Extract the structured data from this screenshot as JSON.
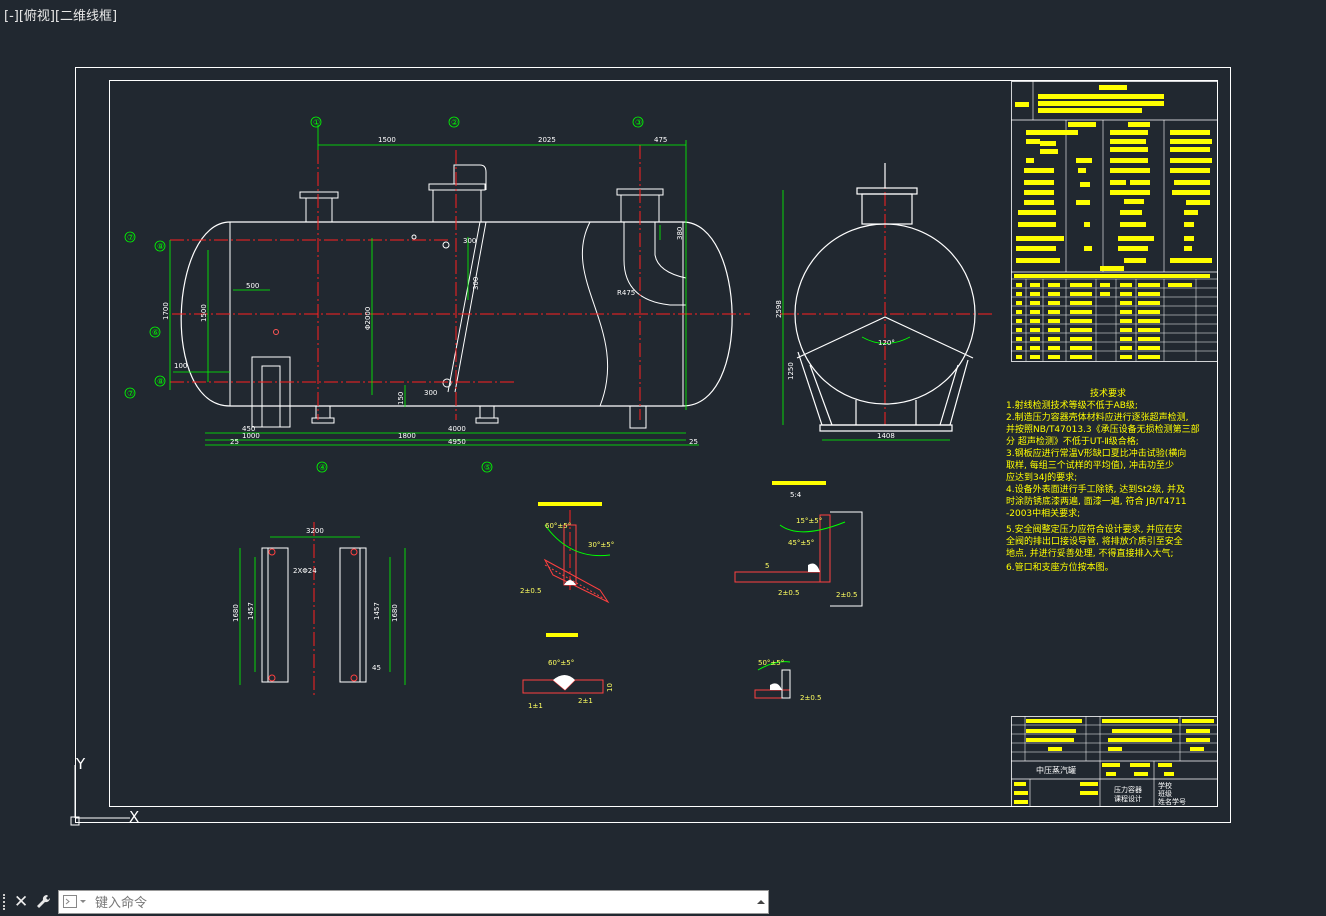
{
  "viewport": {
    "label": "[-][俯视][二维线框]"
  },
  "command_line": {
    "placeholder": "键入命令"
  },
  "ucs": {
    "y_label": "Y",
    "x_label": "X"
  },
  "bubbles": {
    "b1": "①",
    "b2": "②",
    "b3": "③",
    "b4": "④",
    "b5": "⑤",
    "b6": "⑥",
    "b7": "⑦",
    "b8": "⑧"
  },
  "dims": {
    "d1500": "1500",
    "d2025": "2025",
    "d475": "475",
    "d500": "500",
    "d1700": "1700",
    "d1500v": "1500",
    "d2000": "Φ2000",
    "d100": "100",
    "d4000": "4000",
    "d1800": "1800",
    "d4950": "4950",
    "d450": "450",
    "d1000": "1000",
    "d25a": "25",
    "d25b": "25",
    "d300": "300",
    "d300b": "300",
    "d150": "150",
    "r475": "R475",
    "d380": "380",
    "d2598": "2598",
    "d1250": "1250",
    "d1408": "1408",
    "a120": "120°",
    "d3200": "3200",
    "dia24": "2XΦ24",
    "d1680": "1680",
    "d1457": "1457",
    "d1457b": "1457",
    "d1680b": "1680",
    "d45": "45",
    "w1_a": "60°±5°",
    "w1_b": "30°±5°",
    "w1_c": "2±0.5",
    "w2_a": "15°±5°",
    "w2_b": "45°±5°",
    "w2_c": "2±0.5",
    "w2_d": "2±0.5",
    "w2_e": "5",
    "w3_a": "60°±5°",
    "w3_b": "2±1",
    "w3_c": "1±1",
    "w3_d": "10",
    "w4_a": "50°±5°",
    "w4_b": "2±0.5",
    "s1_scale": "5:4"
  },
  "tech": {
    "title": "技术要求",
    "lines": [
      "1.射线检测技术等级不低于AB级;",
      "2.制造压力容器壳体材料应进行逐张超声检测,",
      "并按照NB/T47013.3《承压设备无损检测第三部",
      "分 超声检测》不低于UT-Ⅱ级合格;",
      "3.钢板应进行常温V形缺口夏比冲击试验(横向",
      "取样, 每组三个试样的平均值), 冲击功至少",
      "应达到34J的要求;",
      "4.设备外表面进行手工除锈, 达到St2级, 并及",
      "时涂防锈底漆两遍, 面漆一遍, 符合 JB/T4711",
      "-2003中相关要求;",
      "5.安全阀整定压力应符合设计要求, 并应在安",
      "全阀的排出口接设导管, 将排放介质引至安全",
      "地点, 并进行妥善处理, 不得直接排入大气;",
      "6.管口和支座方位按本图。"
    ]
  },
  "title_block": {
    "name": "中压蒸汽罐",
    "course1": "压力容器",
    "course2": "课程设计",
    "info1": "学校",
    "info2": "班级",
    "info3": "姓名学号"
  },
  "colors": {
    "background": "#212830",
    "outline": "#ffffff",
    "centerline": "#ff0000",
    "dimension": "#00ff00",
    "highlight": "#ffff00"
  }
}
